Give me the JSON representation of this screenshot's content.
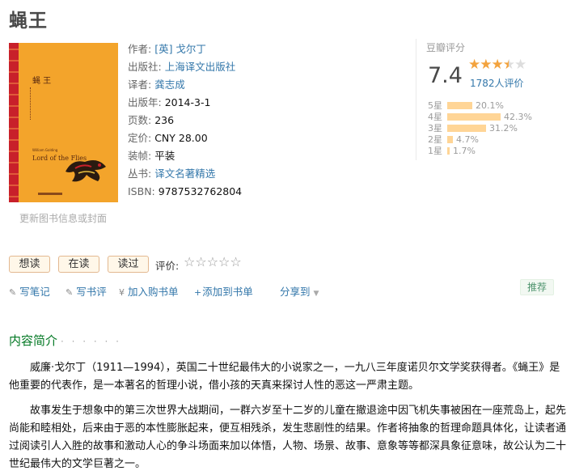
{
  "book": {
    "title": "蝇王",
    "cover": {
      "cn_title": "蝇 王",
      "en_author": "William Golding",
      "en_title": "Lord of the Flies"
    },
    "update_link": "更新图书信息或封面"
  },
  "info": {
    "author_label": "作者:",
    "author": "[英] 戈尔丁",
    "publisher_label": "出版社:",
    "publisher": "上海译文出版社",
    "translator_label": "译者:",
    "translator": "龚志成",
    "year_label": "出版年:",
    "year": "2014-3-1",
    "pages_label": "页数:",
    "pages": "236",
    "price_label": "定价:",
    "price": "CNY 28.00",
    "binding_label": "装帧:",
    "binding": "平装",
    "series_label": "丛书:",
    "series": "译文名著精选",
    "isbn_label": "ISBN:",
    "isbn": "9787532762804"
  },
  "rating": {
    "header": "豆瓣评分",
    "score": "7.4",
    "votes": "1782人评价",
    "stars_value": 3.5,
    "distribution": [
      {
        "label": "5星",
        "pct": "20.1%",
        "value": 20.1
      },
      {
        "label": "4星",
        "pct": "42.3%",
        "value": 42.3
      },
      {
        "label": "3星",
        "pct": "31.2%",
        "value": 31.2
      },
      {
        "label": "2星",
        "pct": "4.7%",
        "value": 4.7
      },
      {
        "label": "1星",
        "pct": "1.7%",
        "value": 1.7
      }
    ]
  },
  "actions": {
    "want_read": "想读",
    "reading": "在读",
    "read": "读过",
    "rate_label": "评价:",
    "write_note": "写笔记",
    "write_review": "写书评",
    "add_cart": "加入购书单",
    "add_booklist": "添加到书单",
    "share": "分享到",
    "recommend": "推荐"
  },
  "intro": {
    "title": "内容简介",
    "dots": "· · · · · ·",
    "p1": "威廉·戈尔丁（1911—1994），英国二十世纪最伟大的小说家之一，一九八三年度诺贝尔文学奖获得者。《蝇王》是他重要的代表作，是一本著名的哲理小说，借小孩的天真来探讨人性的恶这一严肃主题。",
    "p2": "故事发生于想象中的第三次世界大战期间，一群六岁至十二岁的儿童在撤退途中因飞机失事被困在一座荒岛上，起先尚能和睦相处，后来由于恶的本性膨胀起来，便互相残杀，发生悲剧性的结果。作者将抽象的哲理命题具体化，让读者通过阅读引人入胜的故事和激动人心的争斗场面来加以体悟，人物、场景、故事、意象等等都深具象征意味，故公认为二十世纪最伟大的文学巨著之一。"
  }
}
